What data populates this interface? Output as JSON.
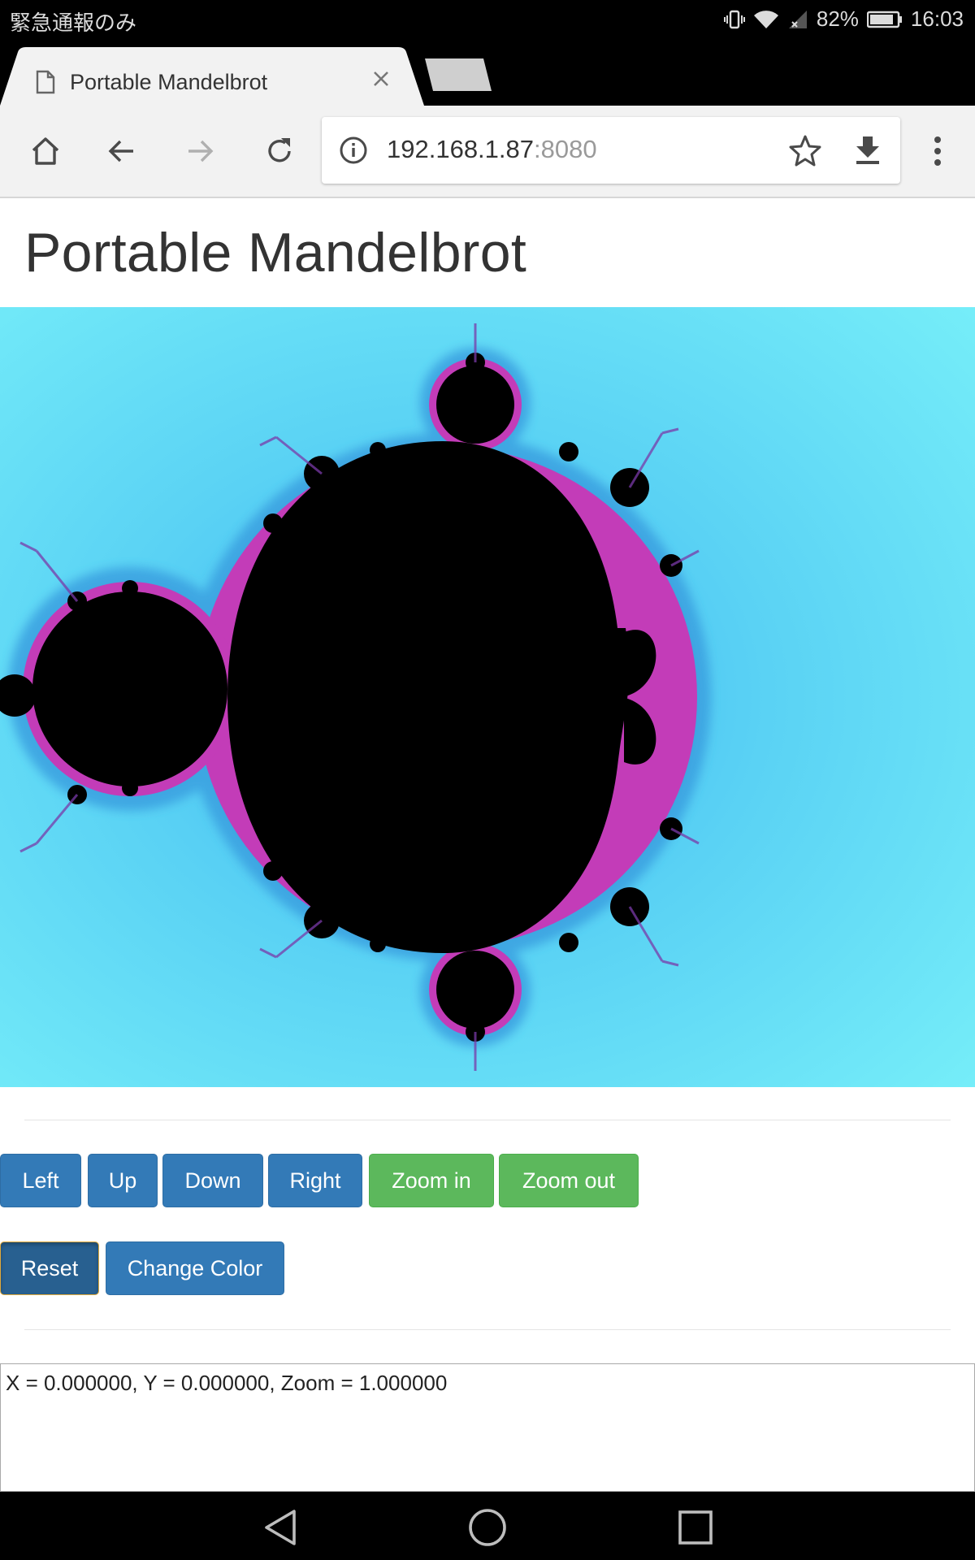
{
  "status_bar": {
    "carrier": "緊急通報のみ",
    "battery": "82%",
    "time": "16:03",
    "icons": [
      "vibrate-icon",
      "wifi-icon",
      "signal-icon",
      "battery-icon"
    ]
  },
  "browser": {
    "tab_title": "Portable Mandelbrot",
    "url_host": "192.168.1.87",
    "url_port": ":8080"
  },
  "page": {
    "title": "Portable Mandelbrot",
    "buttons_row1": [
      {
        "label": "Left"
      },
      {
        "label": "Up"
      },
      {
        "label": "Down"
      },
      {
        "label": "Right"
      },
      {
        "label": "Zoom in"
      },
      {
        "label": "Zoom out"
      }
    ],
    "buttons_row2": [
      {
        "label": "Reset"
      },
      {
        "label": "Change Color"
      }
    ],
    "output": "X = 0.000000, Y = 0.000000, Zoom = 1.000000"
  },
  "colors": {
    "background": "#6fe6f7",
    "primary": "#337ab7",
    "success": "#5cb85c"
  }
}
